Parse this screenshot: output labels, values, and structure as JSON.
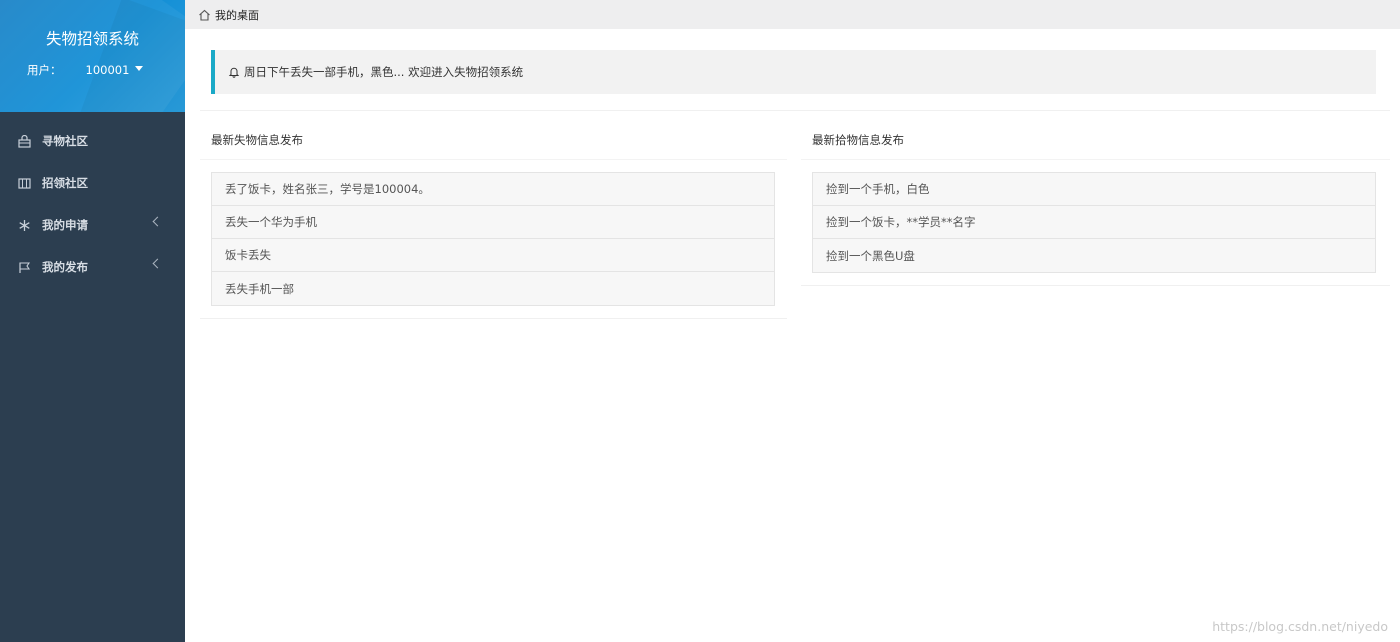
{
  "sidebar": {
    "title": "失物招领系统",
    "user_label": "用户：",
    "user_id": "100001",
    "items": [
      {
        "label": "寻物社区",
        "icon": "shopping-bag-icon"
      },
      {
        "label": "招领社区",
        "icon": "columns-icon"
      },
      {
        "label": "我的申请",
        "icon": "snowflake-icon",
        "has_submenu": true
      },
      {
        "label": "我的发布",
        "icon": "flag-icon",
        "has_submenu": true
      }
    ]
  },
  "topbar": {
    "breadcrumb": "我的桌面",
    "icon": "home-icon"
  },
  "notice": {
    "text": "周日下午丢失一部手机，黑色... 欢迎进入失物招领系统",
    "icon": "bell-icon"
  },
  "lost": {
    "title": "最新失物信息发布",
    "items": [
      "丢了饭卡，姓名张三，学号是100004。",
      "丢失一个华为手机",
      "饭卡丢失",
      "丢失手机一部"
    ]
  },
  "found": {
    "title": "最新拾物信息发布",
    "items": [
      "捡到一个手机，白色",
      "捡到一个饭卡，**学员**名字",
      "捡到一个黑色U盘"
    ]
  },
  "watermark": "https://blog.csdn.net/niyedo",
  "colors": {
    "sidebar_bg": "#2c3e50",
    "header_blue": "#1590d6",
    "notice_accent": "#1aa9c7"
  }
}
